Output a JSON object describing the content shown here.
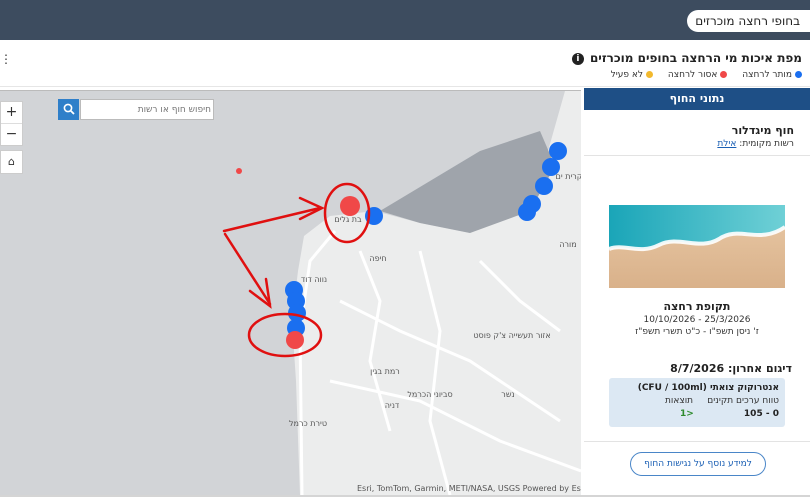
{
  "header": {
    "title_pill": "בחופי רחצה מוכרזים"
  },
  "page_title": "מפת איכות מי הרחצה בחופים מוכרזים",
  "legend": [
    {
      "label": "מותר לרחצה",
      "color": "#1a6ff0"
    },
    {
      "label": "אסור לרחצה",
      "color": "#f04848"
    },
    {
      "label": "לא פעיל",
      "color": "#f2b92e"
    }
  ],
  "left_menu": "⋮",
  "map": {
    "search_placeholder": "חיפוש חוף או רשות",
    "zoom_in": "+",
    "zoom_out": "−",
    "home": "⌂",
    "attribution": "Esri, TomTom, Garmin, METI/NASA, USGS   Powered by Esri",
    "labels": [
      "קרית ים",
      "בת גלים",
      "חיפה",
      "נווה דוד",
      "אזור תעשייה צ'ק פוסט",
      "רמת בגין",
      "סביוני הכרמל",
      "דניה",
      "טירת כרמל",
      "נשר",
      "מורה"
    ]
  },
  "panel": {
    "header": "נתוני החוף",
    "beach_name": "חוף מיגדלור",
    "authority_label": "רשות מקומית:",
    "authority_link": "אילת",
    "season_title": "תקופת רחצה",
    "season_dates": "10/10/2026 - 25/3/2026",
    "season_hebrew": "ז' ניסן תשפ\"ו - כ\"ט תשרי תשפ\"ז",
    "last_sample": "דיגום אחרון: 8/7/2026",
    "result_title": "אנטרוקוק צואתי (CFU / 100ml)",
    "range_header": "טווח ערכים תקינים",
    "results_header": "תוצאות",
    "range_value": "0 - 105",
    "result_value": "<1",
    "more_button": "למידע נוסף על נגישות החוף"
  },
  "colors": {
    "allowed": "#1a6ff0",
    "forbidden": "#f04848",
    "annotation": "#e01010",
    "panel_header": "#1e4f86"
  }
}
